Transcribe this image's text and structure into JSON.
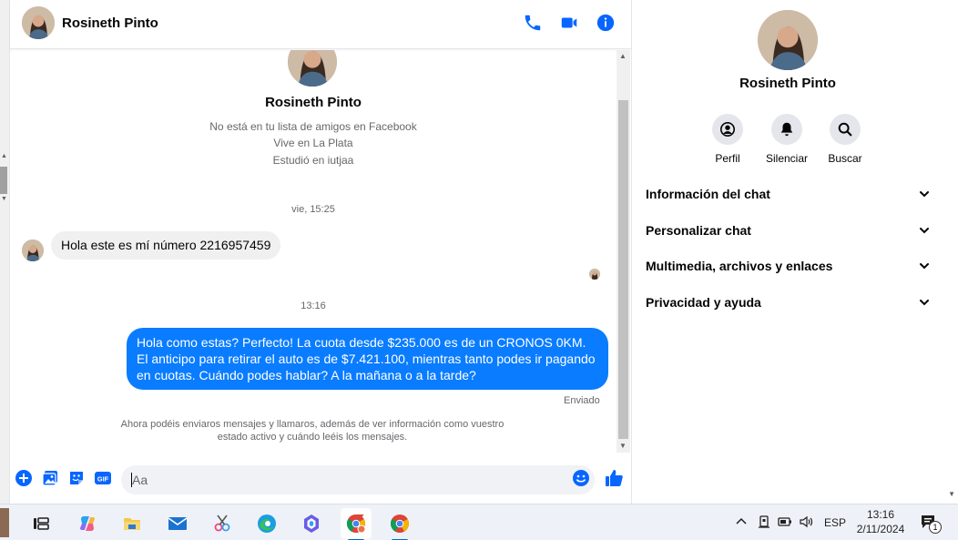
{
  "chat": {
    "contact_name": "Rosineth Pinto",
    "profile": {
      "name": "Rosineth Pinto",
      "line1": "No está en tu lista de amigos en Facebook",
      "line2": "Vive en La Plata",
      "line3": "Estudió en iutjaa"
    },
    "timestamp1": "vie, 15:25",
    "incoming_message": "Hola este es mí número 2216957459",
    "timestamp2": "13:16",
    "outgoing_message": "Hola como estas? Perfecto! La cuota desde $235.000 es de un CRONOS 0KM. El anticipo para retirar el auto es de $7.421.100, mientras tanto podes ir pagando en cuotas. Cuándo podes hablar? A la mañana o a la tarde?",
    "sent_status": "Enviado",
    "notice": "Ahora podéis enviaros mensajes y llamaros, además de ver información como vuestro estado activo y cuándo leéis los mensajes.",
    "composer_placeholder": "Aa",
    "gif_label": "GIF"
  },
  "info_panel": {
    "name": "Rosineth Pinto",
    "actions": [
      {
        "label": "Perfil",
        "icon": "profile-icon"
      },
      {
        "label": "Silenciar",
        "icon": "bell-icon"
      },
      {
        "label": "Buscar",
        "icon": "search-icon"
      }
    ],
    "sections": [
      {
        "title": "Información del chat"
      },
      {
        "title": "Personalizar chat"
      },
      {
        "title": "Multimedia, archivos y enlaces"
      },
      {
        "title": "Privacidad y ayuda"
      }
    ]
  },
  "taskbar": {
    "apps": [
      "task-view-icon",
      "copilot-icon",
      "file-explorer-icon",
      "mail-icon",
      "snipping-tool-icon",
      "edge-icon",
      "copilot-app-icon",
      "chrome-profile-icon",
      "chrome-icon"
    ],
    "language": "ESP",
    "time": "13:16",
    "date": "2/11/2024",
    "notification_count": "1"
  },
  "colors": {
    "messenger_blue": "#0a7cff",
    "accent_blue": "#0866ff"
  }
}
